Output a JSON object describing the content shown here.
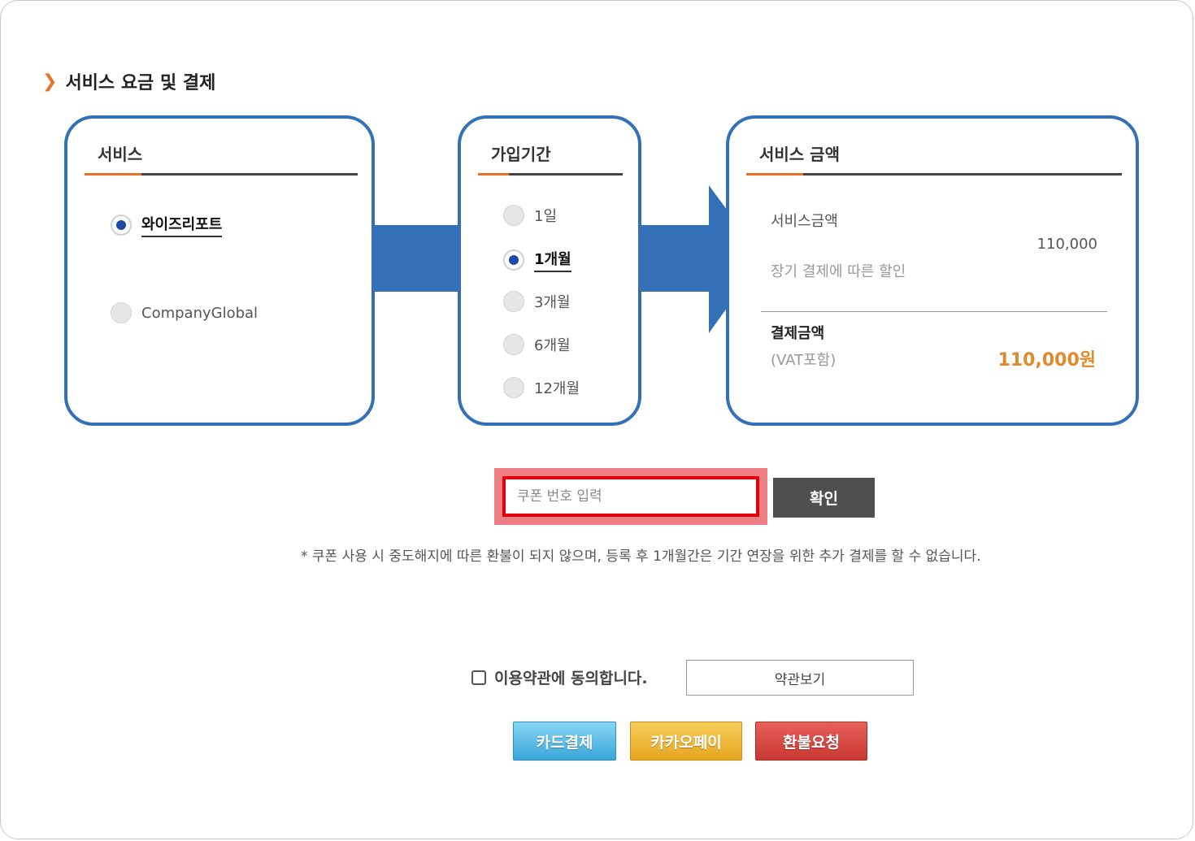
{
  "section": {
    "title": "서비스 요금 및 결제"
  },
  "service_box": {
    "title": "서비스",
    "options": [
      {
        "label": "와이즈리포트",
        "selected": true
      },
      {
        "label": "CompanyGlobal",
        "selected": false
      }
    ]
  },
  "period_box": {
    "title": "가입기간",
    "options": [
      {
        "label": "1일",
        "selected": false
      },
      {
        "label": "1개월",
        "selected": true
      },
      {
        "label": "3개월",
        "selected": false
      },
      {
        "label": "6개월",
        "selected": false
      },
      {
        "label": "12개월",
        "selected": false
      }
    ]
  },
  "amount_box": {
    "title": "서비스 금액",
    "service_amount_label": "서비스금액",
    "service_amount_value": "110,000",
    "discount_label": "장기 결제에 따른 할인",
    "total_label": "결제금액",
    "vat_label": "(VAT포함)",
    "total_value": "110,000원"
  },
  "coupon": {
    "placeholder": "쿠폰 번호 입력",
    "confirm_label": "확인",
    "notice": "* 쿠폰 사용 시 중도해지에 따른 환불이 되지 않으며, 등록 후 1개월간은 기간 연장을 위한 추가 결제를 할 수 없습니다."
  },
  "agreement": {
    "label": "이용약관에 동의합니다.",
    "checked": false,
    "view_terms_label": "약관보기"
  },
  "buttons": {
    "card_pay": "카드결제",
    "kakao_pay": "카카오페이",
    "refund": "환불요청"
  },
  "colors": {
    "box_border": "#3470b8",
    "accent": "#e8702a",
    "total_amount": "#e08a2e",
    "coupon_highlight": "#e0000b"
  }
}
